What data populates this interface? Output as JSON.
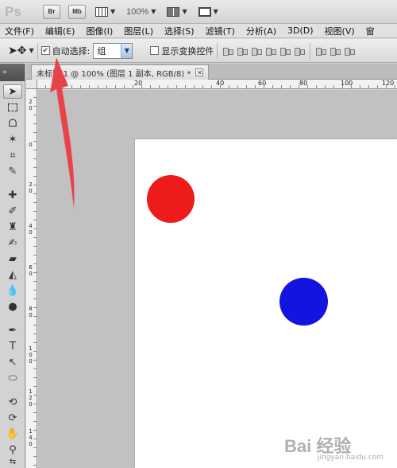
{
  "app": {
    "logo": "Ps",
    "bridge_label": "Br",
    "minibridge_label": "Mb",
    "zoom": "100%"
  },
  "menu": {
    "items": [
      "文件(F)",
      "编辑(E)",
      "图像(I)",
      "图层(L)",
      "选择(S)",
      "滤镜(T)",
      "分析(A)",
      "3D(D)",
      "视图(V)",
      "窗"
    ]
  },
  "options": {
    "auto_select_label": "自动选择:",
    "auto_select_checked": true,
    "auto_select_value": "组",
    "show_transform_label": "显示变换控件",
    "show_transform_checked": false
  },
  "document": {
    "tab_title": "未标题-1 @ 100% (图层 1 副本, RGB/8) *",
    "close_glyph": "✕"
  },
  "rulers": {
    "h_labels": [
      "0",
      "20",
      "40",
      "60",
      "80",
      "100",
      "120"
    ],
    "v_labels": [
      "2\n0",
      "0",
      "2\n0",
      "4\n0",
      "6\n0",
      "8\n0",
      "1\n0\n0",
      "1\n2\n0",
      "1\n4\n0"
    ]
  },
  "canvas": {
    "red_circle_color": "#ee1b1b",
    "blue_circle_color": "#1414e0"
  },
  "annotation": {
    "arrow_color": "#e8434a"
  },
  "watermark": {
    "brand": "Bai 经验",
    "url": "jingyan.baidu.com"
  }
}
